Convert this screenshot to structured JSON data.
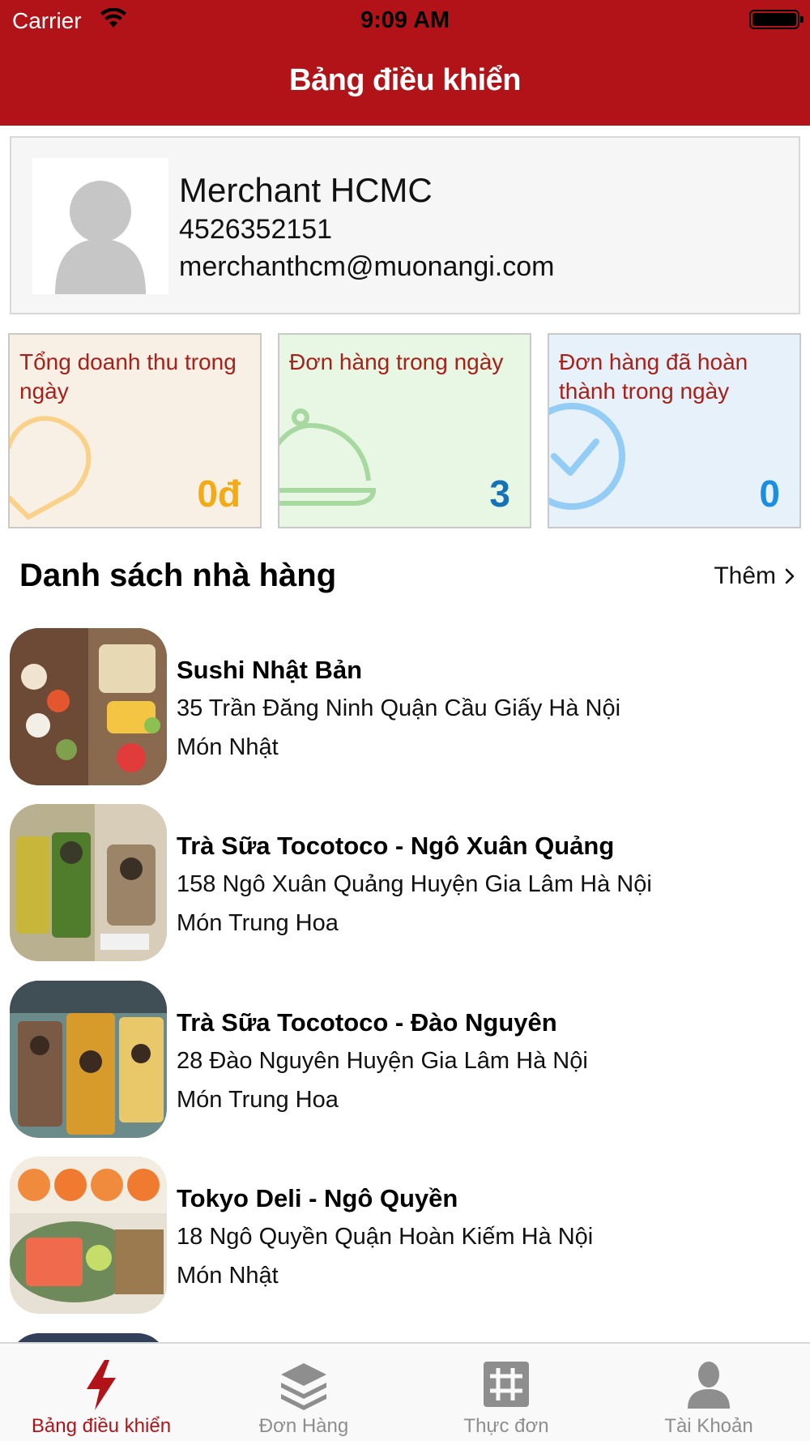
{
  "status_bar": {
    "carrier": "Carrier",
    "time": "9:09 AM"
  },
  "nav": {
    "title": "Bảng điều khiển"
  },
  "profile": {
    "name": "Merchant HCMC",
    "phone": "4526352151",
    "email": "merchanthcm@muonangi.com"
  },
  "stats": [
    {
      "label": "Tổng doanh thu trong ngày",
      "value": "0đ",
      "icon": "heart-icon",
      "color": "#f3aa14"
    },
    {
      "label": "Đơn hàng trong ngày",
      "value": "3",
      "icon": "cloche-icon",
      "color": "#1572b8"
    },
    {
      "label": "Đơn hàng đã hoàn thành trong ngày",
      "value": "0",
      "icon": "check-circle-icon",
      "color": "#1a8fe0"
    }
  ],
  "restaurants_section": {
    "title": "Danh sách nhà hàng",
    "more_label": "Thêm"
  },
  "restaurants": [
    {
      "name": "Sushi Nhật Bản",
      "address": "35 Trần Đăng Ninh Quận Cầu Giấy Hà Nội",
      "category": "Món Nhật"
    },
    {
      "name": "Trà Sữa Tocotoco - Ngô Xuân Quảng",
      "address": "158 Ngô Xuân Quảng Huyện Gia Lâm Hà Nội",
      "category": "Món Trung Hoa"
    },
    {
      "name": "Trà Sữa Tocotoco - Đào Nguyên",
      "address": "28 Đào Nguyên Huyện Gia Lâm Hà Nội",
      "category": "Món Trung Hoa"
    },
    {
      "name": "Tokyo Deli - Ngô Quyền",
      "address": "18 Ngô Quyền Quận Hoàn Kiếm Hà Nội",
      "category": "Món Nhật"
    }
  ],
  "tabs": [
    {
      "label": "Bảng điều khiển",
      "icon": "lightning-icon",
      "active": true
    },
    {
      "label": "Đơn Hàng",
      "icon": "layers-icon",
      "active": false
    },
    {
      "label": "Thực đơn",
      "icon": "grid-icon",
      "active": false
    },
    {
      "label": "Tài Khoản",
      "icon": "person-icon",
      "active": false
    }
  ],
  "colors": {
    "brand": "#b21318",
    "tab_inactive": "#8e8e8e"
  }
}
